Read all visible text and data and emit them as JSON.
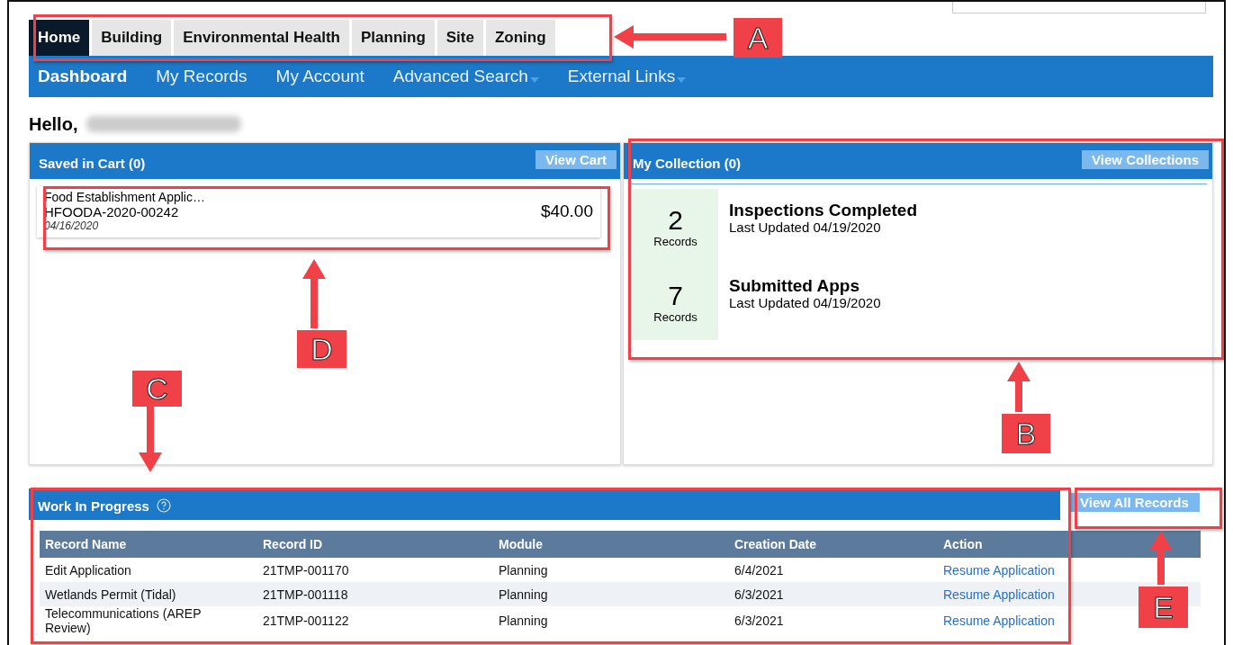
{
  "module_tabs": [
    {
      "label": "Home",
      "selected": true
    },
    {
      "label": "Building",
      "selected": false
    },
    {
      "label": "Environmental Health",
      "selected": false
    },
    {
      "label": "Planning",
      "selected": false
    },
    {
      "label": "Site",
      "selected": false
    },
    {
      "label": "Zoning",
      "selected": false
    }
  ],
  "nav": [
    {
      "label": "Dashboard",
      "selected": true,
      "dropdown": false
    },
    {
      "label": "My Records",
      "selected": false,
      "dropdown": false
    },
    {
      "label": "My Account",
      "selected": false,
      "dropdown": false
    },
    {
      "label": "Advanced Search",
      "selected": false,
      "dropdown": true
    },
    {
      "label": "External Links",
      "selected": false,
      "dropdown": true
    }
  ],
  "greeting": "Hello,",
  "cart": {
    "title": "Saved in Cart (0)",
    "button": "View Cart",
    "items": [
      {
        "name": "Food Establishment Applic…",
        "record_id": "HFOODA-2020-00242",
        "date": "04/16/2020",
        "amount": "$40.00"
      }
    ]
  },
  "collection": {
    "title": "My Collection (0)",
    "button": "View Collections",
    "items": [
      {
        "count": "2",
        "unit": "Records",
        "name": "Inspections Completed",
        "updated": "Last Updated 04/19/2020"
      },
      {
        "count": "7",
        "unit": "Records",
        "name": "Submitted Apps",
        "updated": "Last Updated 04/19/2020"
      }
    ]
  },
  "work_in_progress": {
    "title": "Work In Progress",
    "button": "View All Records",
    "columns": [
      "Record Name",
      "Record ID",
      "Module",
      "Creation Date",
      "Action"
    ],
    "rows": [
      {
        "cells": [
          "Edit Application",
          "21TMP-001170",
          "Planning",
          "6/4/2021"
        ],
        "action": "Resume Application"
      },
      {
        "cells": [
          "Wetlands Permit (Tidal)",
          "21TMP-001118",
          "Planning",
          "6/3/2021"
        ],
        "action": "Resume Application"
      },
      {
        "cells": [
          "Telecommunications (AREP Review)",
          "21TMP-001122",
          "Planning",
          "6/3/2021"
        ],
        "action": "Resume Application"
      }
    ]
  },
  "callouts": [
    "A",
    "B",
    "C",
    "D",
    "E"
  ]
}
